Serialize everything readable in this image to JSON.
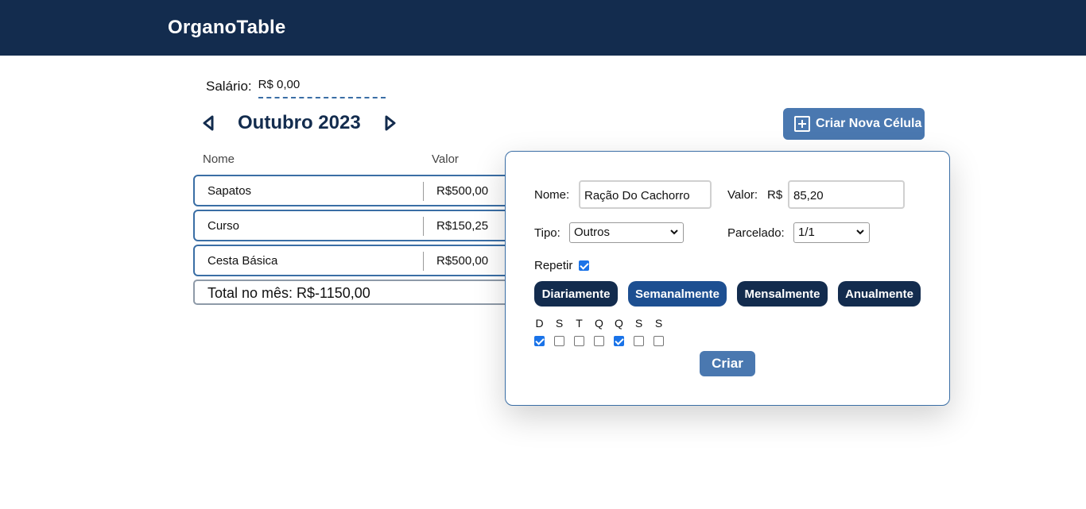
{
  "header": {
    "brand": "OrganoTable"
  },
  "salary": {
    "label": "Salário:",
    "value": "R$ 0,00"
  },
  "month_nav": {
    "title": "Outubro 2023"
  },
  "new_cell_button": {
    "label": "Criar Nova Célula"
  },
  "table": {
    "headers": {
      "name": "Nome",
      "value": "Valor"
    },
    "rows": [
      {
        "name": "Sapatos",
        "value": "R$500,00"
      },
      {
        "name": "Curso",
        "value": "R$150,25"
      },
      {
        "name": "Cesta Básica",
        "value": "R$500,00"
      }
    ],
    "total": "Total no mês: R$-1150,00"
  },
  "modal": {
    "name_label": "Nome:",
    "name_value": "Ração Do Cachorro",
    "value_label": "Valor:",
    "currency": "R$",
    "value_value": "85,20",
    "type_label": "Tipo:",
    "type_selected": "Outros",
    "installment_label": "Parcelado:",
    "installment_selected": "1/1",
    "repeat_label": "Repetir",
    "repeat_checked": true,
    "frequencies": [
      {
        "label": "Diariamente",
        "active": false
      },
      {
        "label": "Semanalmente",
        "active": true
      },
      {
        "label": "Mensalmente",
        "active": false
      },
      {
        "label": "Anualmente",
        "active": false
      }
    ],
    "days": [
      {
        "letter": "D",
        "checked": true
      },
      {
        "letter": "S",
        "checked": false
      },
      {
        "letter": "T",
        "checked": false
      },
      {
        "letter": "Q",
        "checked": false
      },
      {
        "letter": "Q",
        "checked": true
      },
      {
        "letter": "S",
        "checked": false
      },
      {
        "letter": "S",
        "checked": false
      }
    ],
    "create_label": "Criar"
  },
  "colors": {
    "header_bg": "#132c4e",
    "accent": "#4a78b0",
    "active_frequency": "#1d4f91"
  }
}
